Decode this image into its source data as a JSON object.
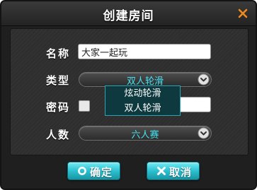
{
  "dialog": {
    "title": "创建房间",
    "close_icon": "close-x-icon"
  },
  "form": {
    "name_label": "名称",
    "name_value": "大家一起玩",
    "type_label": "类型",
    "type_value": "双人轮滑",
    "password_label": "密码",
    "password_checked": false,
    "password_value": "",
    "players_label": "人数",
    "players_value": "六人赛"
  },
  "type_dropdown": {
    "options": [
      "炫动轮滑",
      "双人轮滑"
    ]
  },
  "footer": {
    "confirm_label": "确定",
    "cancel_label": "取消",
    "confirm_icon": "circle-icon",
    "cancel_icon": "x-icon"
  },
  "colors": {
    "accent": "#2cc0d0",
    "select_text": "#45e1f2",
    "background": "#2e2e2e"
  }
}
